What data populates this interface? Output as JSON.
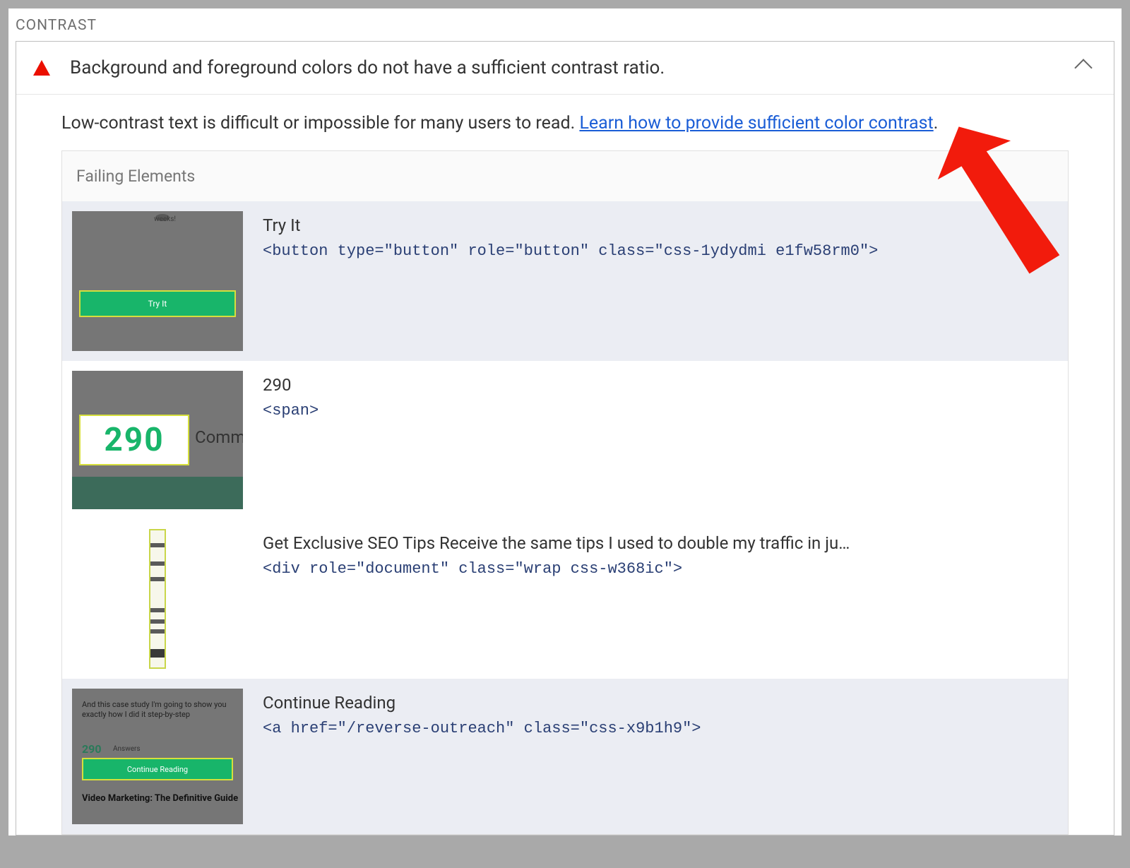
{
  "section": {
    "title": "CONTRAST"
  },
  "audit": {
    "title": "Background and foreground colors do not have a sufficient contrast ratio.",
    "description_prefix": "Low-contrast text is difficult or impossible for many users to read. ",
    "link_text": "Learn how to provide sufficient color contrast",
    "description_suffix": "."
  },
  "failing": {
    "header": "Failing Elements",
    "items": [
      {
        "label": "Try It",
        "code": "<button type=\"button\" role=\"button\" class=\"css-1ydydmi e1fw58rm0\">",
        "thumb": {
          "btn_text": "Try It",
          "top_text": "weeks!"
        }
      },
      {
        "label": "290",
        "code": "<span>",
        "thumb": {
          "number": "290",
          "side_text": "Comme"
        }
      },
      {
        "label": "Get Exclusive SEO Tips Receive the same tips I used to double my traffic in ju…",
        "code": "<div role=\"document\" class=\"wrap css-w368ic\">"
      },
      {
        "label": "Continue Reading",
        "code": "<a href=\"/reverse-outreach\" class=\"css-x9b1h9\">",
        "thumb": {
          "para": "And this case study I'm going to show you exactly how I did it step-by-step",
          "num": "290",
          "numside": "Answers",
          "btn_text": "Continue Reading",
          "bold": "Video Marketing: The Definitive Guide"
        }
      }
    ]
  }
}
